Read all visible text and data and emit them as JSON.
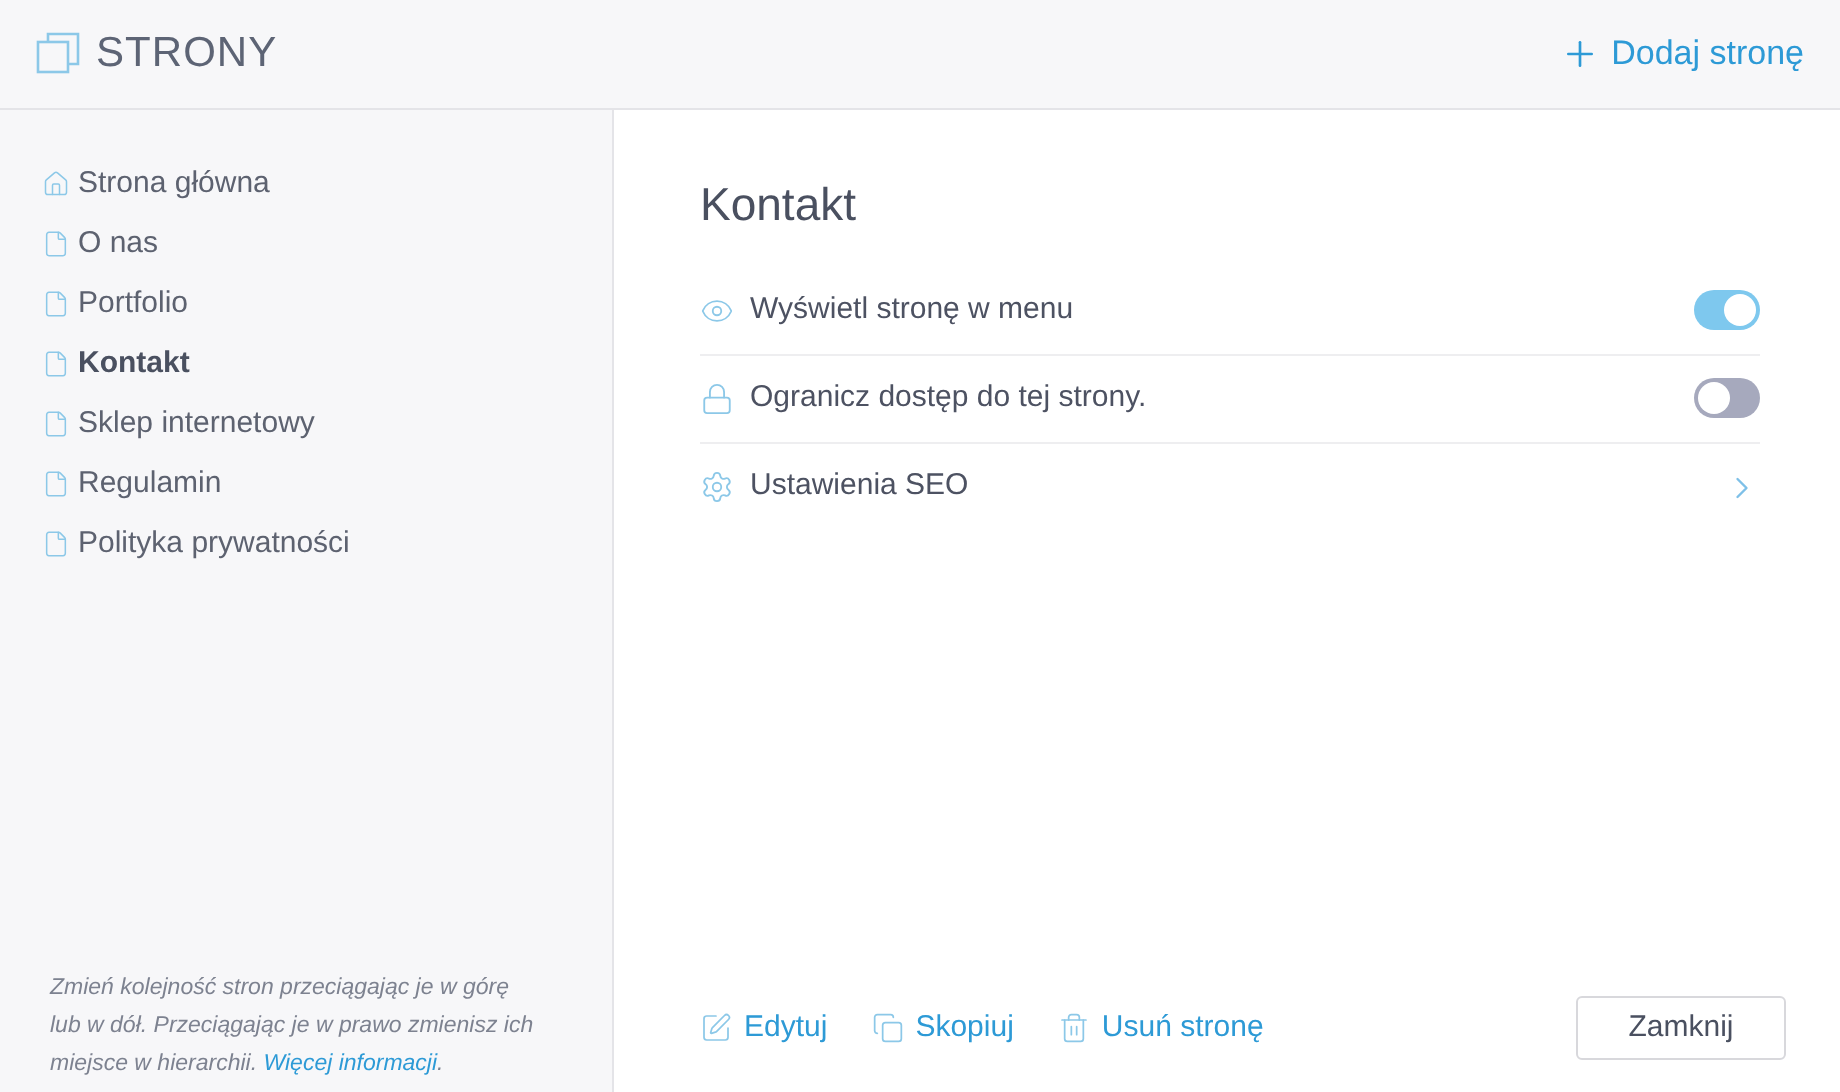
{
  "header": {
    "title": "STRONY",
    "add_button": "Dodaj stronę"
  },
  "sidebar": {
    "items": [
      {
        "label": "Strona główna",
        "kind": "home",
        "selected": false
      },
      {
        "label": "O nas",
        "kind": "page",
        "selected": false
      },
      {
        "label": "Portfolio",
        "kind": "page",
        "selected": false
      },
      {
        "label": "Kontakt",
        "kind": "page",
        "selected": true
      },
      {
        "label": "Sklep internetowy",
        "kind": "page",
        "selected": false
      },
      {
        "label": "Regulamin",
        "kind": "page",
        "selected": false
      },
      {
        "label": "Polityka prywatności",
        "kind": "page",
        "selected": false
      }
    ],
    "hint": {
      "text": "Zmień kolejność stron przeciągając je w górę lub w dół. Przeciągając je w prawo zmienisz ich miejsce w hierarchii. ",
      "link": "Więcej informacji",
      "end": "."
    }
  },
  "page": {
    "title": "Kontakt",
    "settings": [
      {
        "label": "Wyświetl stronę w menu",
        "kind": "toggle",
        "on": true
      },
      {
        "label": "Ogranicz dostęp do tej strony.",
        "kind": "toggle",
        "on": false
      },
      {
        "label": "Ustawienia SEO",
        "kind": "link"
      }
    ]
  },
  "actions": [
    "Edytuj",
    "Skopiuj",
    "Usuń stronę"
  ],
  "close_button": "Zamknij"
}
